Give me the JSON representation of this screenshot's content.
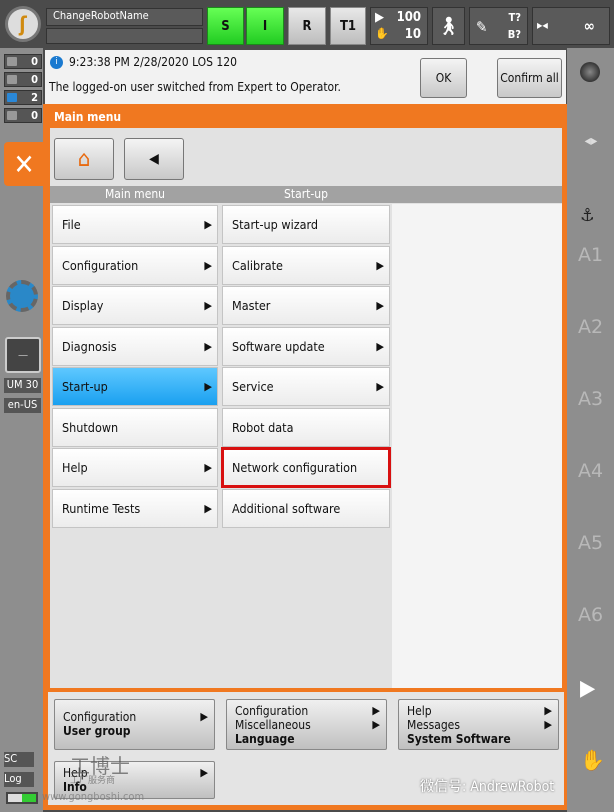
{
  "header": {
    "robot_name": "ChangeRobotName",
    "status_s": "S",
    "status_i": "I",
    "status_r": "R",
    "mode": "T1",
    "override_prog": "100",
    "override_jog": "10",
    "tool_t": "T?",
    "tool_b": "B?",
    "infinite": "∞",
    "colors": {
      "green": "#33dd33",
      "orange": "#f07820"
    }
  },
  "message": {
    "timestamp": "9:23:38 PM 2/28/2020 LOS 120",
    "text": "The logged-on user switched from Expert to Operator.",
    "ok_label": "OK",
    "confirm_all_label": "Confirm all"
  },
  "left": {
    "counters": [
      "0",
      "0",
      "2",
      "0"
    ],
    "um": "UM 30",
    "lang": "en-US"
  },
  "menu": {
    "title": "Main menu",
    "col1_header": "Main menu",
    "col2_header": "Start-up",
    "col1": [
      {
        "label": "File",
        "arrow": true
      },
      {
        "label": "Configuration",
        "arrow": true
      },
      {
        "label": "Display",
        "arrow": true
      },
      {
        "label": "Diagnosis",
        "arrow": true
      },
      {
        "label": "Start-up",
        "arrow": true,
        "selected": true
      },
      {
        "label": "Shutdown",
        "arrow": false
      },
      {
        "label": "Help",
        "arrow": true
      },
      {
        "label": "Runtime Tests",
        "arrow": true
      }
    ],
    "col2": [
      {
        "label": "Start-up wizard",
        "arrow": false
      },
      {
        "label": "Calibrate",
        "arrow": true
      },
      {
        "label": "Master",
        "arrow": true
      },
      {
        "label": "Software update",
        "arrow": true
      },
      {
        "label": "Service",
        "arrow": true
      },
      {
        "label": "Robot data",
        "arrow": false
      },
      {
        "label": "Network configuration",
        "arrow": false,
        "highlighted": true
      },
      {
        "label": "Additional software",
        "arrow": false
      }
    ]
  },
  "recent": [
    {
      "lines": [
        "Configuration"
      ],
      "bold": "User group"
    },
    {
      "lines": [
        "Configuration",
        "Miscellaneous"
      ],
      "bold": "Language"
    },
    {
      "lines": [
        "Help",
        "Messages"
      ],
      "bold": "System Software"
    },
    {
      "lines": [
        "Help"
      ],
      "bold": "Info"
    }
  ],
  "right": {
    "axes": [
      "A1",
      "A2",
      "A3",
      "A4",
      "A5",
      "A6"
    ]
  },
  "watermark": {
    "cn_logo": "工博士",
    "cn_sub": "工厂服务商",
    "site": "www.gongboshi.com",
    "wechat": "微信号: AndrewRobot",
    "left_sc": "SC",
    "left_log": "Log"
  }
}
